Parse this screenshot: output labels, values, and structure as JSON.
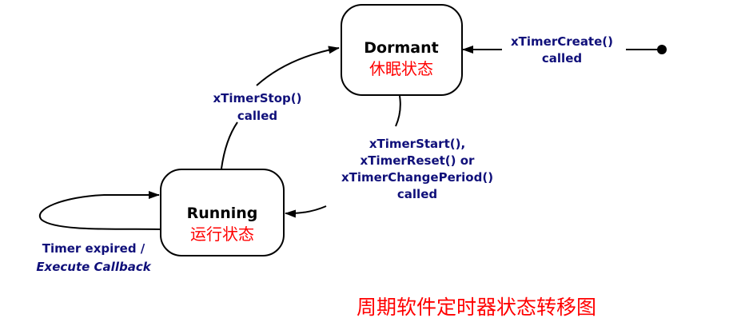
{
  "states": {
    "dormant": {
      "name": "Dormant",
      "cn": "休眠状态"
    },
    "running": {
      "name": "Running",
      "cn": "运行状态"
    }
  },
  "transitions": {
    "create": {
      "line1": "xTimerCreate()",
      "line2": "called"
    },
    "stop": {
      "line1": "xTimerStop()",
      "line2": "called"
    },
    "start": {
      "line1": "xTimerStart(),",
      "line2": "xTimerReset() or",
      "line3": "xTimerChangePeriod()",
      "line4": "called"
    },
    "expired": {
      "line1": "Timer expired /",
      "line2": "Execute Callback"
    }
  },
  "caption": "周期软件定时器状态转移图",
  "colors": {
    "label_text": "#10107a",
    "chinese_text": "#ff0000",
    "lines": "#000000"
  }
}
